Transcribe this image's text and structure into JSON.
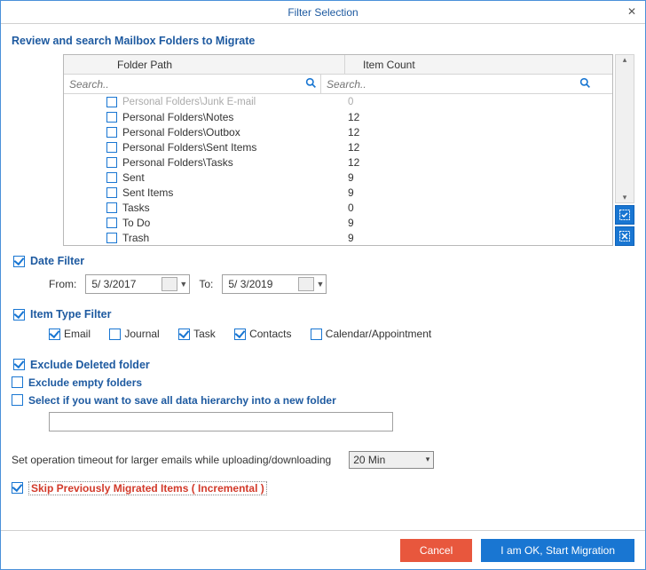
{
  "window": {
    "title": "Filter Selection"
  },
  "heading": "Review and search Mailbox Folders to Migrate",
  "grid": {
    "headers": {
      "path": "Folder Path",
      "count": "Item Count"
    },
    "search_placeholder": "Search..",
    "rows": [
      {
        "path": "Personal Folders\\Junk E-mail",
        "count": "0"
      },
      {
        "path": "Personal Folders\\Notes",
        "count": "12"
      },
      {
        "path": "Personal Folders\\Outbox",
        "count": "12"
      },
      {
        "path": "Personal Folders\\Sent Items",
        "count": "12"
      },
      {
        "path": "Personal Folders\\Tasks",
        "count": "12"
      },
      {
        "path": "Sent",
        "count": "9"
      },
      {
        "path": "Sent Items",
        "count": "9"
      },
      {
        "path": "Tasks",
        "count": "0"
      },
      {
        "path": "To Do",
        "count": "9"
      },
      {
        "path": "Trash",
        "count": "9"
      }
    ]
  },
  "date_filter": {
    "label": "Date Filter",
    "from_label": "From:",
    "to_label": "To:",
    "from": "5/  3/2017",
    "to": "5/  3/2019"
  },
  "item_type_filter": {
    "label": "Item Type Filter",
    "options": {
      "email": "Email",
      "journal": "Journal",
      "task": "Task",
      "contacts": "Contacts",
      "calendar": "Calendar/Appointment"
    }
  },
  "exclude_deleted": "Exclude Deleted folder",
  "exclude_empty": "Exclude empty folders",
  "save_hierarchy": "Select if you want to save all data hierarchy into a new folder",
  "timeout": {
    "label": "Set operation timeout for larger emails while uploading/downloading",
    "value": "20 Min"
  },
  "skip_prev": "Skip Previously Migrated Items ( Incremental )",
  "buttons": {
    "cancel": "Cancel",
    "ok": "I am OK, Start Migration"
  }
}
